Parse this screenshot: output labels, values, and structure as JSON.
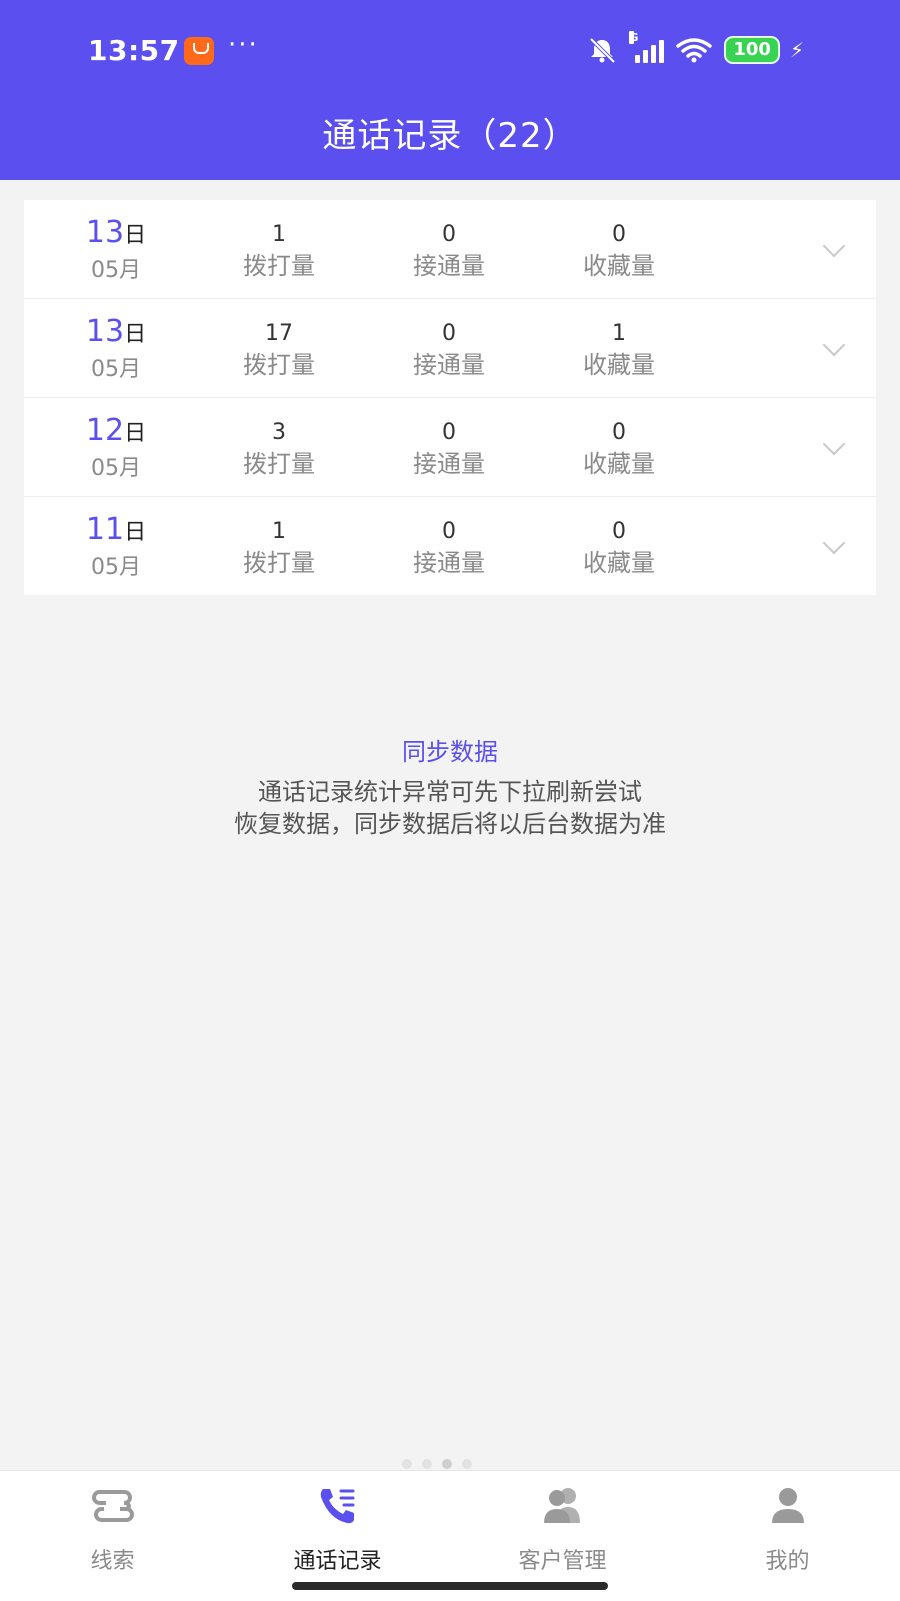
{
  "status_bar": {
    "time": "13:57",
    "more": "···",
    "battery": "100",
    "network": "G",
    "charging": "⚡"
  },
  "header": {
    "title": "通话记录（22）",
    "background_color": "#5b4ff0"
  },
  "call_records": [
    {
      "day": "13",
      "day_suffix": "日",
      "month": "05月",
      "dialed": "1",
      "dialed_label": "拨打量",
      "connected": "0",
      "connected_label": "接通量",
      "favorited": "0",
      "favorited_label": "收藏量"
    },
    {
      "day": "13",
      "day_suffix": "日",
      "month": "05月",
      "dialed": "17",
      "dialed_label": "拨打量",
      "connected": "0",
      "connected_label": "接通量",
      "favorited": "1",
      "favorited_label": "收藏量"
    },
    {
      "day": "12",
      "day_suffix": "日",
      "month": "05月",
      "dialed": "3",
      "dialed_label": "拨打量",
      "connected": "0",
      "connected_label": "接通量",
      "favorited": "0",
      "favorited_label": "收藏量"
    },
    {
      "day": "11",
      "day_suffix": "日",
      "month": "05月",
      "dialed": "1",
      "dialed_label": "拨打量",
      "connected": "0",
      "connected_label": "接通量",
      "favorited": "0",
      "favorited_label": "收藏量"
    }
  ],
  "sync": {
    "title": "同步数据",
    "line1": "通话记录统计异常可先下拉刷新尝试",
    "line2": "恢复数据，同步数据后将以后台数据为准"
  },
  "bottom_nav": {
    "items": [
      {
        "label": "线索",
        "icon": "route-icon"
      },
      {
        "label": "通话记录",
        "icon": "phone-list-icon"
      },
      {
        "label": "客户管理",
        "icon": "users-icon"
      },
      {
        "label": "我的",
        "icon": "user-icon"
      }
    ],
    "active_index": 1,
    "accent_color": "#5b4ff0"
  }
}
